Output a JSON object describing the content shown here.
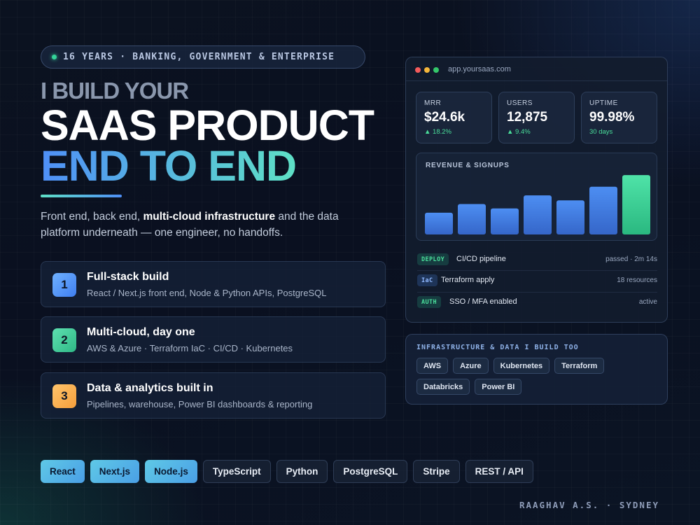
{
  "tagline": {
    "text": "16 YEARS  ·  BANKING, GOVERNMENT & ENTERPRISE"
  },
  "headline": {
    "line1": "I BUILD YOUR",
    "line2": "SAAS PRODUCT",
    "line3": "END TO END"
  },
  "intro": {
    "before": "Front end, back end, ",
    "bold": "multi-cloud infrastructure",
    "after": " and the data platform underneath — one engineer, no handoffs."
  },
  "features": [
    {
      "number": "1",
      "title": "Full-stack build",
      "description": "React / Next.js front end, Node & Python APIs, PostgreSQL"
    },
    {
      "number": "2",
      "title": "Multi-cloud, day one",
      "description": "AWS & Azure · Terraform IaC · CI/CD · Kubernetes"
    },
    {
      "number": "3",
      "title": "Data & analytics built in",
      "description": "Pipelines, warehouse, Power BI dashboards & reporting"
    }
  ],
  "tech_tags": [
    "React",
    "Next.js",
    "Node.js",
    "TypeScript",
    "Python",
    "PostgreSQL",
    "Stripe",
    "REST / API"
  ],
  "signature": "RAAGHAV A.S. · SYDNEY",
  "window": {
    "url": "app.yoursaas.com",
    "metrics": [
      {
        "label": "MRR",
        "value": "$24.6k",
        "delta": "▲ 18.2%"
      },
      {
        "label": "USERS",
        "value": "12,875",
        "delta": "▲ 9.4%"
      },
      {
        "label": "UPTIME",
        "value": "99.98%",
        "delta": "30 days"
      }
    ],
    "chart_title": "REVENUE & SIGNUPS",
    "status_rows": [
      {
        "badge": "DEPLOY",
        "text": "CI/CD pipeline",
        "meta": "passed · 2m 14s"
      },
      {
        "badge": "IaC",
        "text": "Terraform apply",
        "meta": "18 resources"
      },
      {
        "badge": "AUTH",
        "text": "SSO / MFA enabled",
        "meta": "active"
      }
    ]
  },
  "infra": {
    "title": "INFRASTRUCTURE & DATA I BUILD TOO",
    "tags": [
      "AWS",
      "Azure",
      "Kubernetes",
      "Terraform",
      "Databricks",
      "Power BI"
    ]
  },
  "colors": {
    "accent_blue": "#4f8ff7",
    "accent_teal": "#5ee0c6",
    "success_green": "#34d399",
    "background": "#0b1220"
  },
  "chart_data": {
    "type": "bar",
    "title": "REVENUE & SIGNUPS",
    "categories": [
      "",
      "",
      "",
      "",
      "",
      "",
      ""
    ],
    "values": [
      30,
      42,
      36,
      54,
      47,
      66,
      82
    ],
    "highlight_last": true,
    "ylim": [
      0,
      85
    ],
    "grid": false
  }
}
